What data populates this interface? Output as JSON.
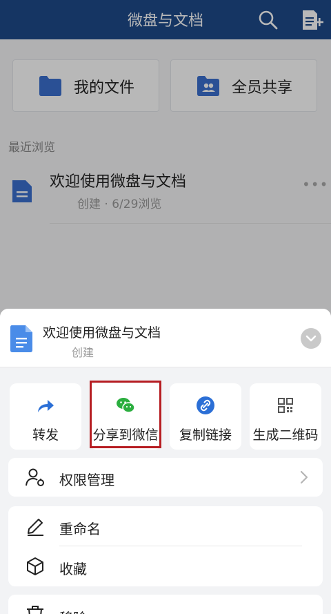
{
  "header": {
    "title": "微盘与文档",
    "search_icon": "search-icon",
    "new_doc_icon": "new-document-icon"
  },
  "shortcuts": [
    {
      "label": "我的文件",
      "icon": "folder-icon"
    },
    {
      "label": "全员共享",
      "icon": "shared-folder-icon"
    }
  ],
  "recent": {
    "section_title": "最近浏览",
    "items": [
      {
        "name": "欢迎使用微盘与文档",
        "meta": "创建 · 6/29浏览",
        "icon": "document-icon"
      }
    ]
  },
  "sheet": {
    "file_name": "欢迎使用微盘与文档",
    "file_sub": "创建",
    "actions": [
      {
        "label": "转发",
        "icon": "forward-icon",
        "color": "#2b6fd6"
      },
      {
        "label": "分享到微信",
        "icon": "wechat-icon",
        "color": "#2bae3f",
        "highlighted": true
      },
      {
        "label": "复制链接",
        "icon": "link-icon",
        "color": "#2b6fd6"
      },
      {
        "label": "生成二维码",
        "icon": "qrcode-icon",
        "color": "#555555"
      }
    ],
    "permission": "权限管理",
    "rename": "重命名",
    "favorite": "收藏",
    "remove": "移除"
  },
  "colors": {
    "header_bg": "#1e4a8a",
    "highlight_border": "#b61d22",
    "doc_blue": "#3d7fe0"
  }
}
